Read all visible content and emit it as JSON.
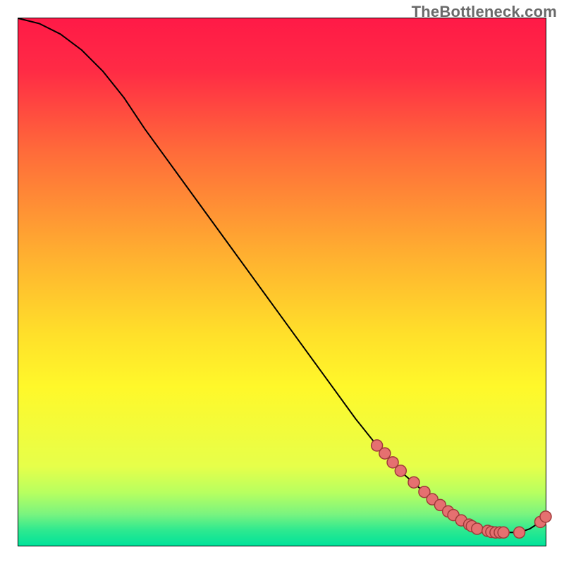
{
  "watermark": "TheBottleneck.com",
  "chart_data": {
    "type": "line",
    "title": "",
    "xlabel": "",
    "ylabel": "",
    "xlim": [
      0,
      100
    ],
    "ylim": [
      0,
      100
    ],
    "grid": false,
    "legend": false,
    "background_gradient": {
      "stops": [
        {
          "offset": 0.0,
          "color": "#ff1a47"
        },
        {
          "offset": 0.1,
          "color": "#ff2b45"
        },
        {
          "offset": 0.25,
          "color": "#ff6a3a"
        },
        {
          "offset": 0.45,
          "color": "#ffb030"
        },
        {
          "offset": 0.6,
          "color": "#ffe02a"
        },
        {
          "offset": 0.7,
          "color": "#fff82a"
        },
        {
          "offset": 0.85,
          "color": "#e6ff4a"
        },
        {
          "offset": 0.9,
          "color": "#b7ff60"
        },
        {
          "offset": 0.94,
          "color": "#7af47f"
        },
        {
          "offset": 0.97,
          "color": "#2fe98f"
        },
        {
          "offset": 1.0,
          "color": "#00e39a"
        }
      ]
    },
    "curve": {
      "stroke": "#000000",
      "stroke_width": 2,
      "x": [
        0,
        4,
        8,
        12,
        16,
        20,
        24,
        28,
        32,
        36,
        40,
        44,
        48,
        52,
        56,
        60,
        64,
        68,
        72,
        76,
        80,
        84,
        88,
        92,
        95,
        97,
        99,
        100
      ],
      "y": [
        100,
        99,
        97,
        94,
        90,
        85,
        79,
        73.5,
        68,
        62.5,
        57,
        51.5,
        46,
        40.5,
        35,
        29.5,
        24,
        19,
        14.5,
        11,
        8,
        5.5,
        3.5,
        2.5,
        2.5,
        3.2,
        4.5,
        5.5
      ]
    },
    "markers": {
      "stroke": "#a03a3a",
      "fill": "#e57070",
      "radius": 8,
      "points": [
        {
          "x": 68,
          "y": 19
        },
        {
          "x": 69.5,
          "y": 17.5
        },
        {
          "x": 71,
          "y": 15.8
        },
        {
          "x": 72.5,
          "y": 14.2
        },
        {
          "x": 75,
          "y": 12
        },
        {
          "x": 77,
          "y": 10.2
        },
        {
          "x": 78.5,
          "y": 8.8
        },
        {
          "x": 80,
          "y": 7.7
        },
        {
          "x": 81.5,
          "y": 6.5
        },
        {
          "x": 82.5,
          "y": 5.8
        },
        {
          "x": 84,
          "y": 4.8
        },
        {
          "x": 85.5,
          "y": 4.0
        },
        {
          "x": 86,
          "y": 3.7
        },
        {
          "x": 87,
          "y": 3.2
        },
        {
          "x": 89,
          "y": 2.8
        },
        {
          "x": 89.7,
          "y": 2.6
        },
        {
          "x": 90.5,
          "y": 2.5
        },
        {
          "x": 91.3,
          "y": 2.5
        },
        {
          "x": 92,
          "y": 2.5
        },
        {
          "x": 95,
          "y": 2.5
        },
        {
          "x": 99,
          "y": 4.5
        },
        {
          "x": 100,
          "y": 5.5
        }
      ]
    }
  }
}
